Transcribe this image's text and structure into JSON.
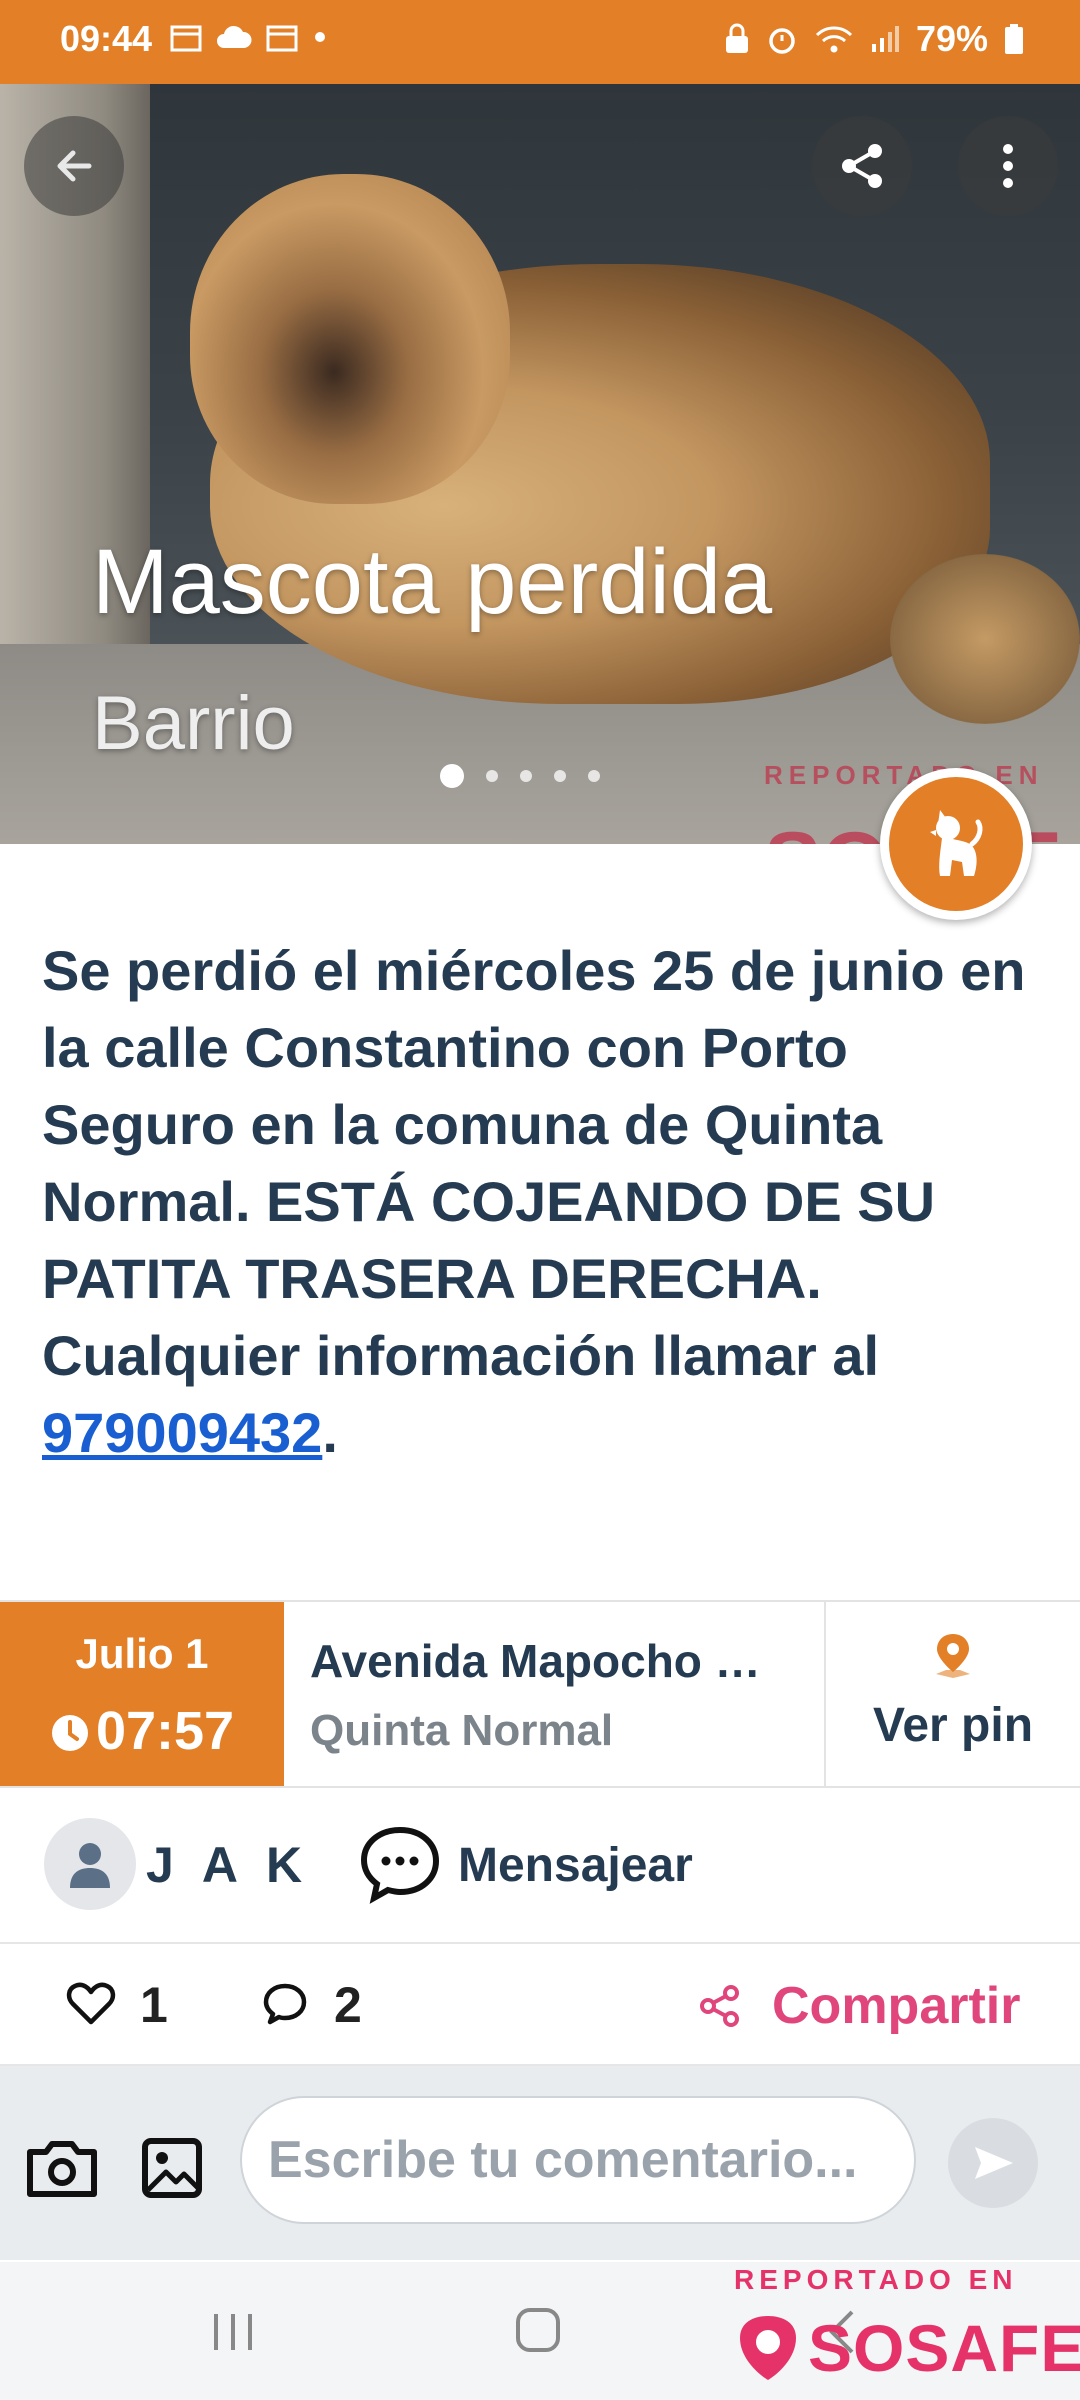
{
  "status_bar": {
    "time": "09:44",
    "battery": "79%",
    "left_icons": [
      "calendar-icon",
      "cloud-icon",
      "calendar-icon",
      "dot-icon"
    ],
    "right_icons": [
      "lock-icon",
      "alarm-icon",
      "wifi-icon",
      "signal-icon",
      "battery-icon"
    ]
  },
  "hero": {
    "title": "Mascota perdida",
    "subtitle": "Barrio",
    "watermark_top": "REPORTADO EN",
    "watermark_brand": "SOSAF",
    "image_dots": {
      "count": 5,
      "active": 0
    },
    "badge_icon": "dog-icon"
  },
  "description": {
    "text": "Se perdió el miércoles 25 de junio en la calle Constantino con Porto Seguro en la comuna de Quinta Normal. ESTÁ COJEANDO DE SU PATITA TRASERA DERECHA. Cualquier información llamar al ",
    "phone": "979009432",
    "suffix": "."
  },
  "info": {
    "date": "Julio 1",
    "time": "07:57",
    "address": "Avenida Mapocho  …",
    "commune": "Quinta Normal",
    "pin_label": "Ver pin"
  },
  "user": {
    "name": "J A K",
    "message_label": "Mensajear"
  },
  "actions": {
    "likes": "1",
    "comments": "2",
    "share_label": "Compartir"
  },
  "composer": {
    "placeholder": "Escribe tu comentario..."
  },
  "branding": {
    "top": "REPORTADO EN",
    "name": "SOSAFE"
  },
  "colors": {
    "accent": "#e27f27",
    "text_dark": "#253b52",
    "link": "#1a5fd1",
    "brand": "#e5336a"
  }
}
